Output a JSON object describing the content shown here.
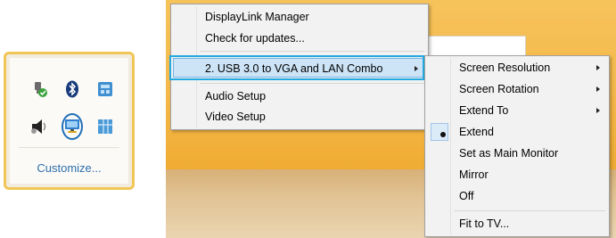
{
  "tray": {
    "icons": [
      "safely-remove-hardware-icon",
      "bluetooth-icon",
      "network-adapter-icon",
      "speaker-icon",
      "displaylink-monitor-icon",
      "window-grid-icon"
    ],
    "selected_icon": "displaylink-monitor-icon",
    "customize_label": "Customize..."
  },
  "main_menu": {
    "items": [
      {
        "label": "DisplayLink Manager"
      },
      {
        "label": "Check for updates..."
      },
      {
        "label": "2. USB 3.0 to VGA and LAN Combo",
        "submenu": true,
        "highlighted": true
      },
      {
        "label": "Audio Setup"
      },
      {
        "label": "Video Setup"
      }
    ]
  },
  "sub_menu": {
    "items": [
      {
        "label": "Screen Resolution",
        "submenu": true
      },
      {
        "label": "Screen Rotation",
        "submenu": true
      },
      {
        "label": "Extend To",
        "submenu": true
      },
      {
        "label": "Extend",
        "checked": true
      },
      {
        "label": "Set as Main Monitor"
      },
      {
        "label": "Mirror"
      },
      {
        "label": "Off"
      },
      {
        "label": "Fit to TV..."
      }
    ]
  },
  "colors": {
    "tray_border": "#f2c557",
    "highlight": "#cde4f7",
    "callout": "#24a9e0",
    "link": "#2e6fad"
  }
}
